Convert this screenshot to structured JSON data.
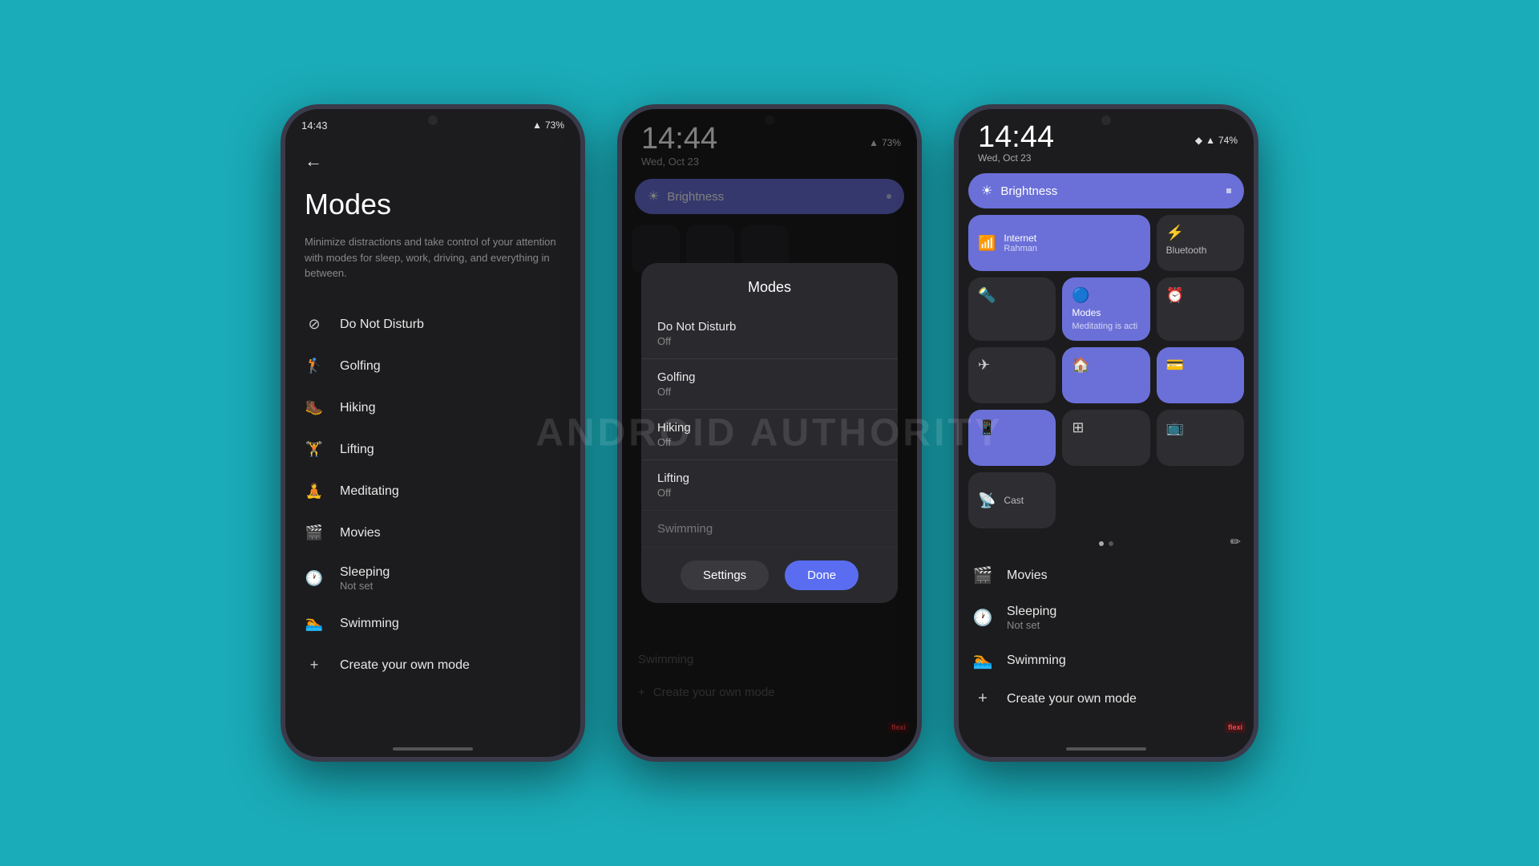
{
  "page": {
    "background_color": "#1aacb8",
    "watermark_text": "ANDROID AUTHORITY"
  },
  "phone1": {
    "status_bar": {
      "time": "14:43",
      "battery": "73%"
    },
    "title": "Modes",
    "subtitle": "Minimize distractions and take control of your attention with modes for sleep, work, driving, and everything in between.",
    "modes": [
      {
        "icon": "⊘",
        "name": "Do Not Disturb"
      },
      {
        "icon": "🏌",
        "name": "Golfing"
      },
      {
        "icon": "🥾",
        "name": "Hiking"
      },
      {
        "icon": "🏋",
        "name": "Lifting"
      },
      {
        "icon": "🧘",
        "name": "Meditating"
      },
      {
        "icon": "🎬",
        "name": "Movies"
      },
      {
        "icon": "🕐",
        "name": "Sleeping",
        "subtext": "Not set"
      },
      {
        "icon": "🏊",
        "name": "Swimming"
      },
      {
        "icon": "+",
        "name": "Create your own mode"
      }
    ]
  },
  "phone2": {
    "status_bar": {
      "time": "14:44",
      "date": "Wed, Oct 23",
      "battery": "73%"
    },
    "brightness_label": "Brightness",
    "modal": {
      "title": "Modes",
      "modes": [
        {
          "name": "Do Not Disturb",
          "status": "Off"
        },
        {
          "name": "Golfing",
          "status": "Off"
        },
        {
          "name": "Hiking",
          "status": "Off"
        },
        {
          "name": "Lifting",
          "status": "Off"
        }
      ],
      "settings_btn": "Settings",
      "done_btn": "Done"
    },
    "below_modal": {
      "swimming": "Swimming",
      "create": "Create your own mode"
    }
  },
  "phone3": {
    "status_bar": {
      "time": "14:44",
      "date": "Wed, Oct 23",
      "battery": "74%"
    },
    "brightness_label": "Brightness",
    "tiles": [
      {
        "id": "internet",
        "icon": "wifi",
        "label": "Internet",
        "sublabel": "Rahman",
        "active": true,
        "wide": false
      },
      {
        "id": "bluetooth",
        "icon": "bluetooth",
        "label": "Bluetooth",
        "sublabel": "",
        "active": false,
        "wide": false
      },
      {
        "id": "flashlight",
        "icon": "flashlight",
        "label": "",
        "sublabel": "",
        "active": false,
        "wide": false
      },
      {
        "id": "modes",
        "icon": "modes",
        "label": "Modes",
        "sublabel": "Meditating is acti...",
        "active": true,
        "wide": false
      },
      {
        "id": "alarm",
        "icon": "alarm",
        "label": "",
        "sublabel": "",
        "active": false,
        "wide": false
      },
      {
        "id": "airplane",
        "icon": "airplane",
        "label": "",
        "sublabel": "",
        "active": false,
        "wide": false
      },
      {
        "id": "home",
        "icon": "home",
        "label": "",
        "sublabel": "",
        "active": true,
        "wide": false
      },
      {
        "id": "wallet",
        "icon": "wallet",
        "label": "",
        "sublabel": "",
        "active": true,
        "wide": false
      },
      {
        "id": "phone-link",
        "icon": "phone-link",
        "label": "",
        "sublabel": "",
        "active": true,
        "wide": false
      },
      {
        "id": "qr",
        "icon": "qr",
        "label": "",
        "sublabel": "",
        "active": false,
        "wide": false
      },
      {
        "id": "screen",
        "icon": "screen",
        "label": "",
        "sublabel": "",
        "active": false,
        "wide": false
      },
      {
        "id": "cast",
        "icon": "cast",
        "label": "Cast",
        "sublabel": "",
        "active": false,
        "wide": true
      }
    ],
    "modes_list": [
      {
        "icon": "🎬",
        "name": "Movies"
      },
      {
        "icon": "🕐",
        "name": "Sleeping",
        "subtext": "Not set"
      },
      {
        "icon": "🏊",
        "name": "Swimming"
      },
      {
        "icon": "+",
        "name": "Create your own mode"
      }
    ]
  }
}
